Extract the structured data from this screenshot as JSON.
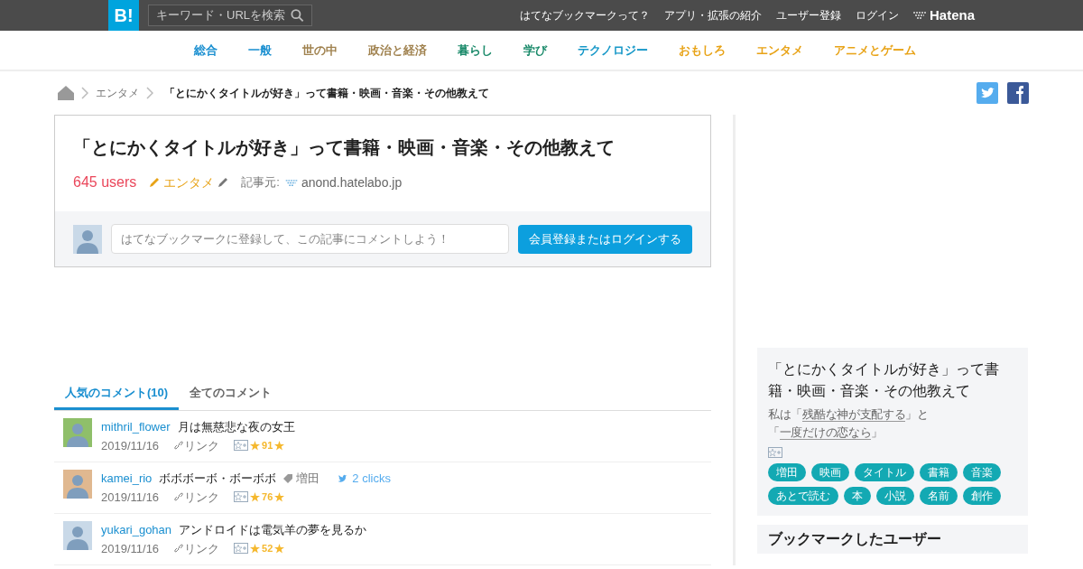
{
  "header": {
    "logo": "B!",
    "search": {
      "placeholder": "キーワード・URLを検索"
    },
    "links": [
      "はてなブックマークって？",
      "アプリ・拡張の紹介",
      "ユーザー登録",
      "ログイン"
    ],
    "brand": "Hatena"
  },
  "categories": [
    {
      "label": "総合",
      "color": "#1a8fd0"
    },
    {
      "label": "一般",
      "color": "#1a8fd0"
    },
    {
      "label": "世の中",
      "color": "#a0824f"
    },
    {
      "label": "政治と経済",
      "color": "#a0824f"
    },
    {
      "label": "暮らし",
      "color": "#1a8a6a"
    },
    {
      "label": "学び",
      "color": "#1a8a6a"
    },
    {
      "label": "テクノロジー",
      "color": "#1798c8"
    },
    {
      "label": "おもしろ",
      "color": "#e8a317"
    },
    {
      "label": "エンタメ",
      "color": "#e8a317"
    },
    {
      "label": "アニメとゲーム",
      "color": "#e8a317"
    }
  ],
  "breadcrumb": [
    "エンタメ",
    "「とにかくタイトルが好き」って書籍・映画・音楽・その他教えて"
  ],
  "entry": {
    "title": "「とにかくタイトルが好き」って書籍・映画・音楽・その他教えて",
    "users": "645 users",
    "category": "エンタメ",
    "source_label": "記事元:",
    "source": "anond.hatelabo.jp",
    "comment": {
      "placeholder": "はてなブックマークに登録して、この記事にコメントしよう！"
    },
    "login_button": "会員登録またはログインする"
  },
  "comment_tabs": [
    {
      "label": "人気のコメント(10)",
      "selected": true
    },
    {
      "label": "全てのコメント",
      "selected": false
    }
  ],
  "comments": [
    {
      "user": "mithril_flower",
      "text": "月は無慈悲な夜の女王",
      "date": "2019/11/16",
      "link": "リンク",
      "stars": "91"
    },
    {
      "user": "kamei_rio",
      "text": "ボボボーボ・ボーボボ",
      "tag": "増田",
      "clicks": "2 clicks",
      "date": "2019/11/16",
      "link": "リンク",
      "stars": "76"
    },
    {
      "user": "yukari_gohan",
      "text": "アンドロイドは電気羊の夢を見るか",
      "date": "2019/11/16",
      "link": "リンク",
      "stars": "52"
    }
  ],
  "sidebar": {
    "title": "「とにかくタイトルが好き」って書籍・映画・音楽・その他教えて",
    "summary": [
      {
        "kind": "text",
        "text": "私は「"
      },
      {
        "kind": "link",
        "text": "残酷な神が支配する"
      },
      {
        "kind": "text",
        "text": "」と「"
      },
      {
        "kind": "link",
        "text": "一度だけの恋なら"
      },
      {
        "kind": "text",
        "text": "」"
      }
    ],
    "tags": [
      "増田",
      "映画",
      "タイトル",
      "書籍",
      "音楽",
      "あとで読む",
      "本",
      "小説",
      "名前",
      "創作"
    ],
    "next_heading": "ブックマークしたユーザー"
  }
}
